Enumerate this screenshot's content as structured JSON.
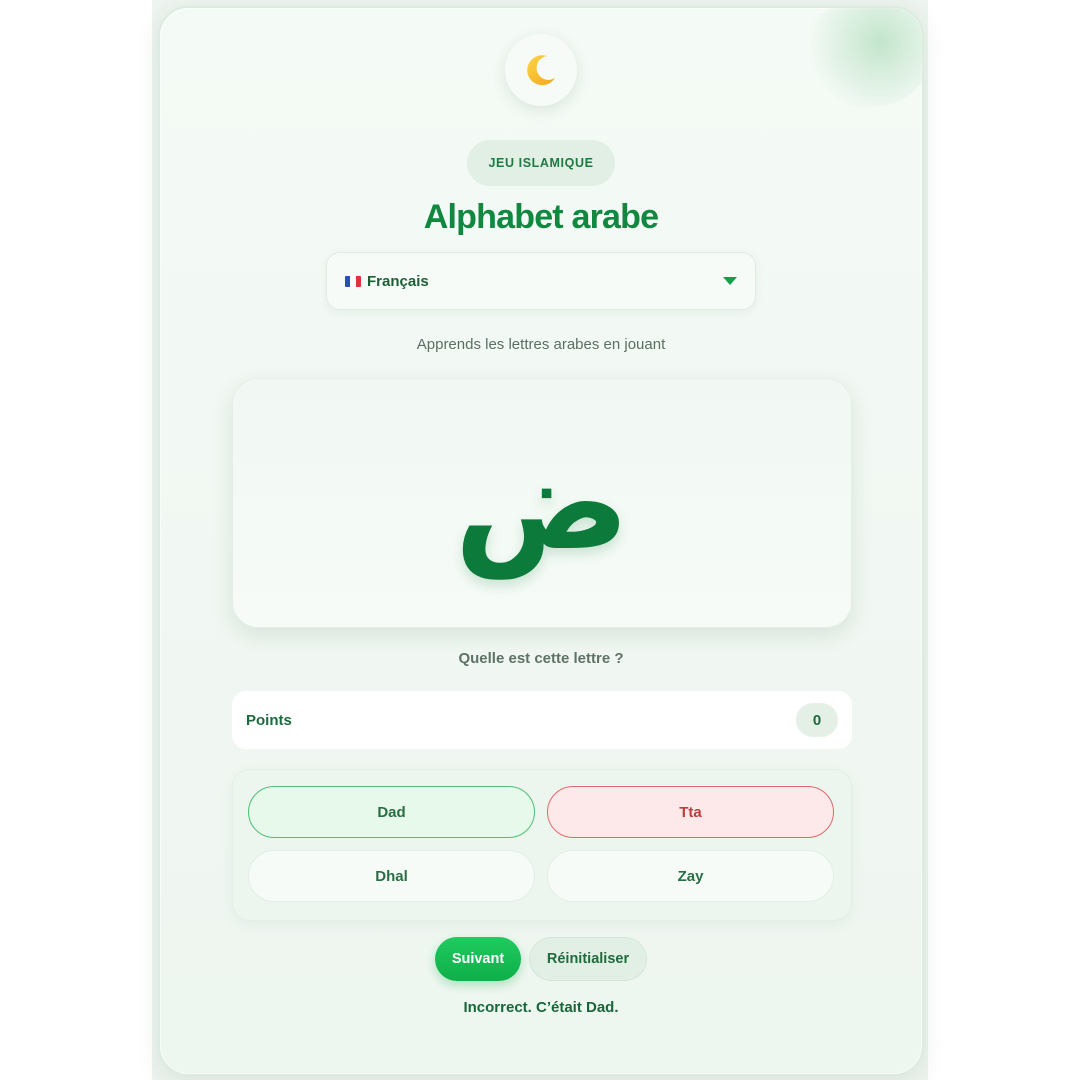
{
  "header": {
    "icon": "crescent-moon-icon",
    "tag": "JEU ISLAMIQUE",
    "title": "Alphabet arabe"
  },
  "language_select": {
    "flag_icon": "france-flag-icon",
    "selected": "Français"
  },
  "subtitle": "Apprends les lettres arabes en jouant",
  "quiz": {
    "letter": "ض",
    "question": "Quelle est cette lettre ?",
    "points_label": "Points",
    "points_value": "0",
    "choices": [
      {
        "label": "Dad",
        "state": "correct"
      },
      {
        "label": "Tta",
        "state": "wrong"
      },
      {
        "label": "Dhal",
        "state": "neutral"
      },
      {
        "label": "Zay",
        "state": "neutral"
      }
    ],
    "next_label": "Suivant",
    "reset_label": "Réinitialiser",
    "feedback": "Incorrect. C’était Dad."
  },
  "colors": {
    "accent": "#11883f",
    "button": "#14b64f",
    "correct_bg": "#e6f9ea",
    "wrong_bg": "#fde9e9",
    "wrong_text": "#c03c3c"
  }
}
